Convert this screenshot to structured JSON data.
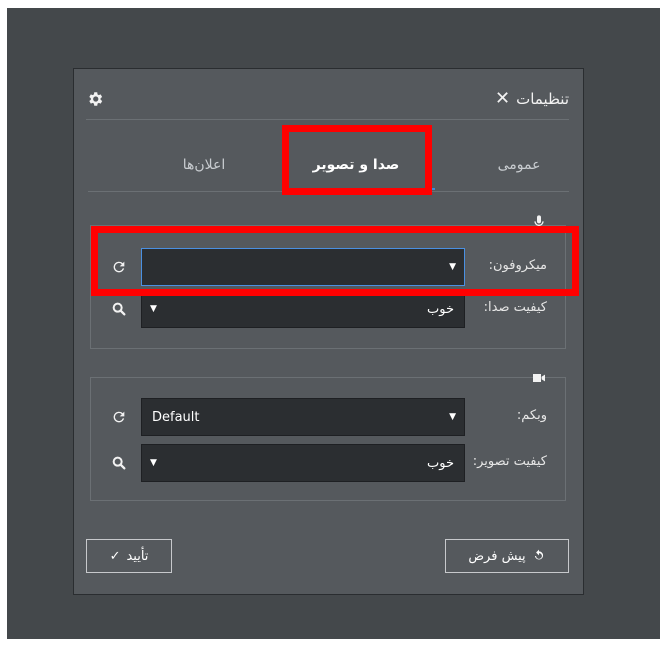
{
  "dialog": {
    "title": "تنظیمات",
    "close_icon": "close-icon",
    "settings_icon": "gear-icon"
  },
  "tabs": [
    {
      "label": "عمومی",
      "active": false
    },
    {
      "label": "صدا و تصویر",
      "active": true
    },
    {
      "label": "اعلان‌ها",
      "active": false
    }
  ],
  "audio": {
    "icon": "microphone-icon",
    "microphone_label": "میکروفون:",
    "microphone_value": "",
    "quality_label": "کیفیت صدا:",
    "quality_value": "خوب"
  },
  "video": {
    "icon": "video-camera-icon",
    "webcam_label": "وبکم:",
    "webcam_value": "Default",
    "quality_label": "کیفیت تصویر:",
    "quality_value": "خوب"
  },
  "buttons": {
    "confirm_label": "تأیید",
    "default_label": "پیش فرض"
  },
  "colors": {
    "highlight": "#ff0000",
    "accent": "#3d8bd9",
    "dialog_bg": "#55595d",
    "field_bg": "#2b2e31"
  }
}
